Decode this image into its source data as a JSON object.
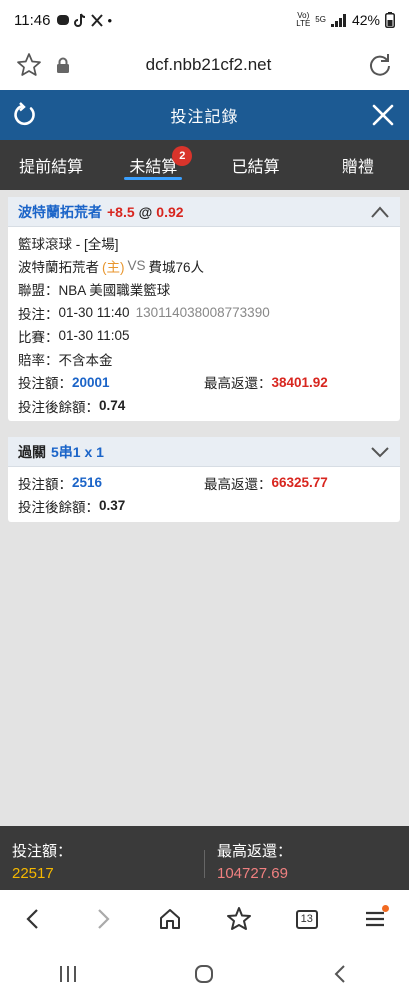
{
  "status_bar": {
    "time": "11:46",
    "dot": "•",
    "network_top": "Vo)",
    "network_bottom": "LTE",
    "signal_label": "5G",
    "battery": "42%"
  },
  "browser": {
    "url": "dcf.nbb21cf2.net",
    "tab_count": "13"
  },
  "app": {
    "title": "投注記錄"
  },
  "tabs": [
    {
      "label": "提前結算"
    },
    {
      "label": "未結算",
      "badge": "2"
    },
    {
      "label": "已結算"
    },
    {
      "label": "贈禮"
    }
  ],
  "bet1": {
    "team": "波特蘭拓荒者",
    "handicap": "+8.5",
    "at": "@",
    "odds": "0.92",
    "sport": "籃球滾球 - [全場]",
    "home_team": "波特蘭拓荒者",
    "home_tag": "(主)",
    "vs": "VS",
    "away_team": "費城76人",
    "league_label": "聯盟：",
    "league": "NBA 美國職業籃球",
    "bet_time_label": "投注：",
    "bet_time": "01-30 11:40",
    "bet_id": "130114038008773390",
    "match_time_label": "比賽：",
    "match_time": "01-30 11:05",
    "odds_type_label": "賠率：",
    "odds_type": "不含本金",
    "stake_label": "投注額：",
    "stake": "20001",
    "max_return_label": "最高返還：",
    "max_return": "38401.92",
    "balance_label": "投注後餘額：",
    "balance": "0.74"
  },
  "bet2": {
    "title": "過關",
    "combo": "5串1 x 1",
    "stake_label": "投注額：",
    "stake": "2516",
    "max_return_label": "最高返還：",
    "max_return": "66325.77",
    "balance_label": "投注後餘額：",
    "balance": "0.37"
  },
  "summary": {
    "stake_label": "投注額：",
    "stake": "22517",
    "max_return_label": "最高返還：",
    "max_return": "104727.69"
  },
  "colors": {
    "header": "#1c5a93",
    "tab_bar": "#3a3a3a",
    "accent_blue": "#1b64c8",
    "accent_red": "#d8261f",
    "summary_yellow": "#f5b800",
    "summary_pink": "#f08080"
  },
  "icons": [
    "star-icon",
    "lock-icon",
    "reload-icon",
    "refresh-icon",
    "close-icon",
    "chevron-up-icon",
    "chevron-down-icon",
    "back-icon",
    "forward-icon",
    "home-icon",
    "bookmark-icon",
    "tabs-icon",
    "menu-icon"
  ]
}
